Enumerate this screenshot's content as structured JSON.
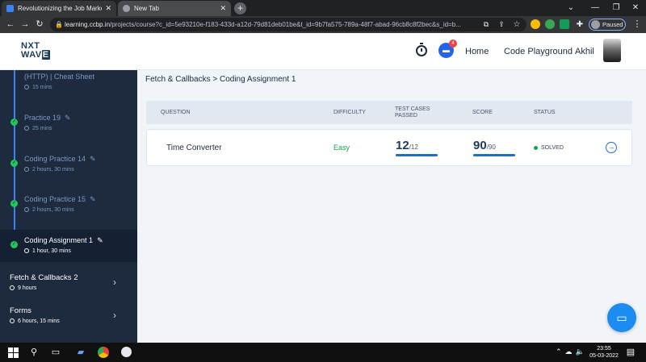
{
  "browser": {
    "tabs": [
      {
        "title": "Revolutionizing the Job Market | ..."
      },
      {
        "title": "New Tab"
      }
    ],
    "address": {
      "host": "learning.ccbp.in",
      "path": "/projects/course?c_id=5e93210e-f183-433d-a12d-79d81deb01be&t_id=9b7fa575-789a-48f7-abad-96cb8c8f2bec&s_id=b..."
    },
    "profile_label": "Paused"
  },
  "header": {
    "logo_top": "NXT",
    "logo_bottom_a": "WAV",
    "logo_bottom_b": "E",
    "chat_badge": "4",
    "nav_home": "Home",
    "nav_playground": "Code Playground",
    "user_name": "Akhil"
  },
  "sidebar": {
    "items": [
      {
        "title": "(HTTP) | Cheat Sheet",
        "time": "15 mins",
        "done": false,
        "active": false,
        "editable": false
      },
      {
        "title": "Practice 19",
        "time": "25 mins",
        "done": true,
        "active": false,
        "editable": true
      },
      {
        "title": "Coding Practice 14",
        "time": "2 hours, 30 mins",
        "done": true,
        "active": false,
        "editable": true
      },
      {
        "title": "Coding Practice 15",
        "time": "2 hours, 30 mins",
        "done": true,
        "active": false,
        "editable": true
      },
      {
        "title": "Coding Assignment 1",
        "time": "1 hour, 30 mins",
        "done": true,
        "active": true,
        "editable": true
      }
    ],
    "topics": [
      {
        "title": "Fetch & Callbacks 2",
        "time": "9 hours"
      },
      {
        "title": "Forms",
        "time": "6 hours, 15 mins"
      }
    ]
  },
  "main": {
    "breadcrumb": "Fetch & Callbacks > Coding Assignment 1",
    "columns": {
      "question": "QUESTION",
      "difficulty": "DIFFICULTY",
      "tests_line1": "TEST CASES",
      "tests_line2": "PASSED",
      "score": "SCORE",
      "status": "STATUS"
    },
    "rows": [
      {
        "question": "Time Converter",
        "difficulty": "Easy",
        "tests_passed": "12",
        "tests_total": "/12",
        "tests_fraction": 1.0,
        "score": "90",
        "score_total": "/90",
        "score_fraction": 1.0,
        "status": "SOLVED"
      }
    ]
  },
  "taskbar": {
    "time": "23:55",
    "date": "05-03-2022"
  },
  "colors": {
    "sidebar_bg": "#1e2a3d",
    "accent_blue": "#1d6fc6",
    "success_green": "#16a34a"
  }
}
